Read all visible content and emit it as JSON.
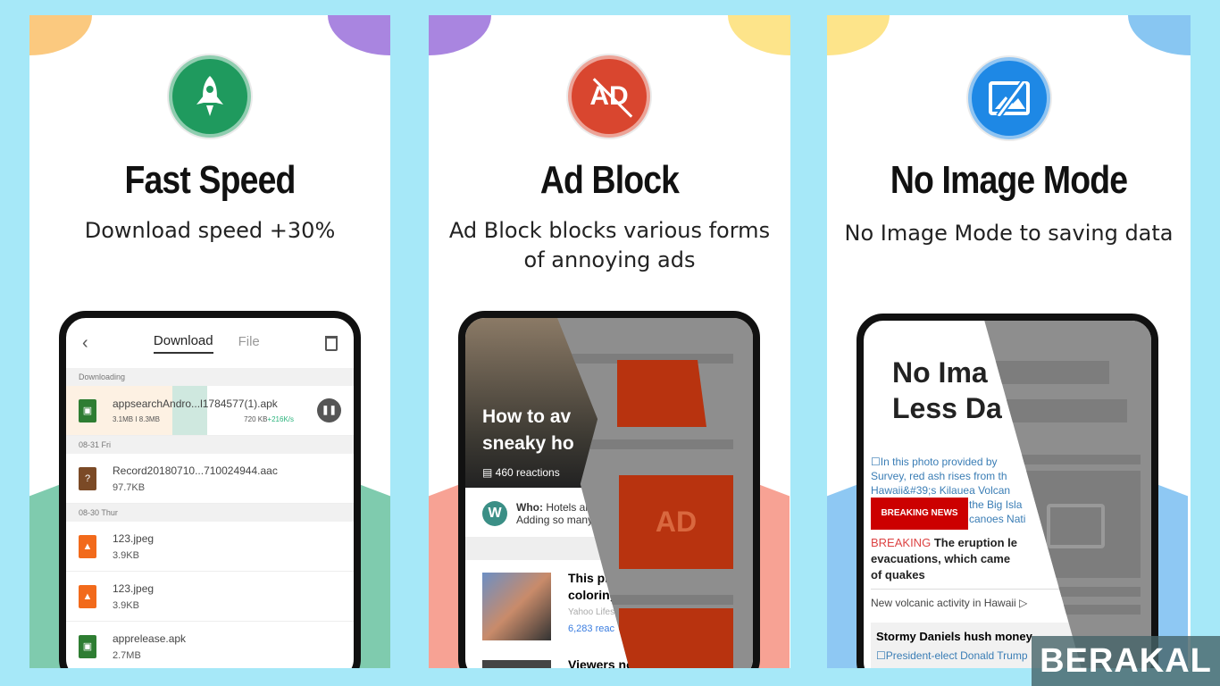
{
  "colors": {
    "background": "#a6e8f8",
    "green": "#1f9a5e",
    "red": "#d9462f",
    "blue": "#1e88e5"
  },
  "panels": [
    {
      "icon": "rocket-icon",
      "title": "Fast Speed",
      "subtitle": [
        "Download speed +30%"
      ],
      "phone": {
        "tabs": [
          "Download",
          "File"
        ],
        "active_tab": "Download",
        "sections": [
          {
            "label": "Downloading",
            "items": [
              {
                "name": "appsearchAndro...l1784577(1).apk",
                "size": "3.1MB I 8.3MB",
                "speed_prefix": "720 KB",
                "speed": "+216K/s",
                "progress": 0.37,
                "icon": "android-file-icon"
              }
            ]
          },
          {
            "label": "08-31 Fri",
            "items": [
              {
                "name": "Record20180710...710024944.aac",
                "size": "97.7KB",
                "icon": "unknown-file-icon"
              }
            ]
          },
          {
            "label": "08-30 Thur",
            "items": [
              {
                "name": "123.jpeg",
                "size": "3.9KB",
                "icon": "image-file-icon"
              },
              {
                "name": "123.jpeg",
                "size": "3.9KB",
                "icon": "image-file-icon"
              },
              {
                "name": "apprelease.apk",
                "size": "2.7MB",
                "icon": "android-file-icon"
              }
            ]
          }
        ]
      }
    },
    {
      "icon": "ad-block-icon",
      "title": "Ad Block",
      "subtitle": [
        "Ad Block blocks various forms",
        "of annoying ads"
      ],
      "phone": {
        "headline": [
          "How to av",
          "sneaky ho"
        ],
        "reactions": "460 reactions",
        "who_label": "Who:",
        "who_text": "Hotels are g",
        "who_text2": "Adding so many f",
        "story1": [
          "This pho",
          "coloring a"
        ],
        "story1_source": "Yahoo Lifesty",
        "story1_reactions": "6,283 reac",
        "story2": "Viewers not",
        "ad_label": "AD"
      }
    },
    {
      "icon": "no-image-icon",
      "title": "No Image Mode",
      "subtitle": [
        "No Image Mode to saving data"
      ],
      "phone": {
        "hero": [
          "No Ima",
          "Less Da"
        ],
        "caption": [
          "In this photo provided by",
          "Survey, red ash rises from th",
          "Hawaii&#39;s Kilauea Volcan",
          "the Big Isla",
          "canoes Nati"
        ],
        "breaking_badge": "BREAKING NEWS",
        "breaking_label": "BREAKING",
        "breaking_text": [
          "The eruption le",
          "evacuations, which came",
          "of quakes"
        ],
        "video": "New volcanic activity in Hawaii",
        "section": "Stormy Daniels hush money",
        "link": "President-elect Donald Trump"
      }
    }
  ],
  "watermark": "BERAKAL"
}
